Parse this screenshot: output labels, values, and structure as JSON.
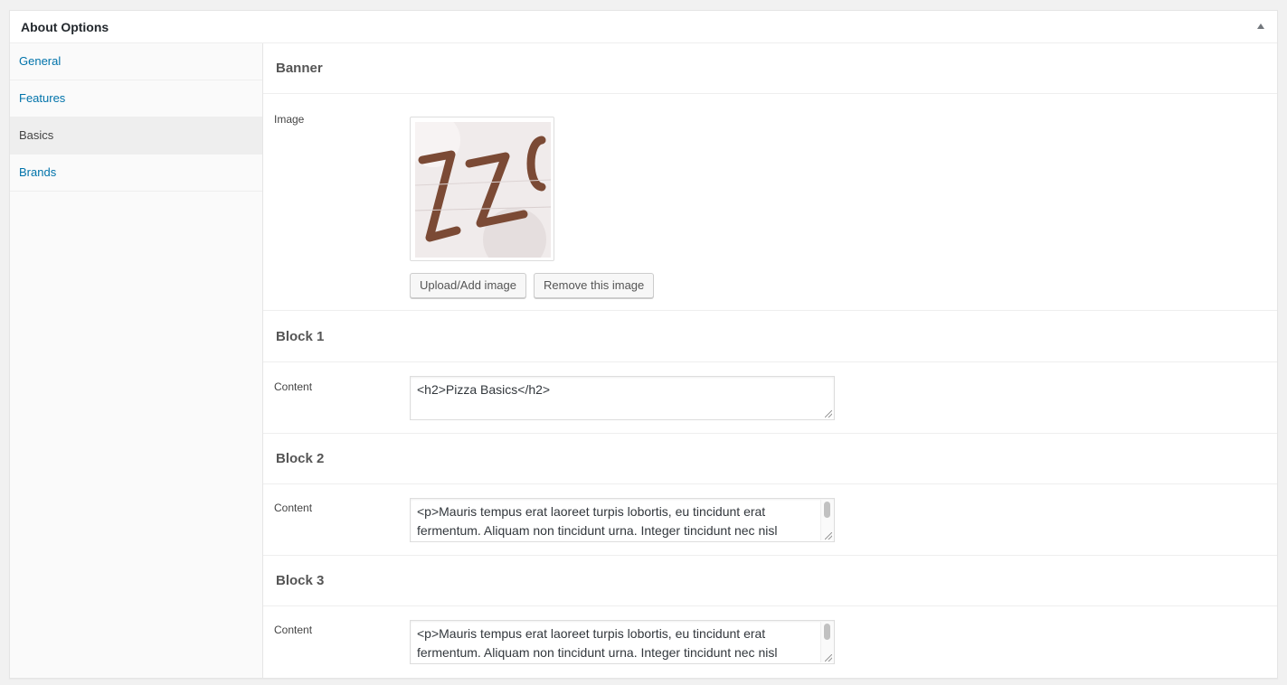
{
  "panel": {
    "title": "About Options"
  },
  "sidebar": {
    "items": [
      {
        "label": "General"
      },
      {
        "label": "Features"
      },
      {
        "label": "Basics"
      },
      {
        "label": "Brands"
      }
    ]
  },
  "banner": {
    "heading": "Banner",
    "image_label": "Image",
    "upload_label": "Upload/Add image",
    "remove_label": "Remove this image"
  },
  "block1": {
    "heading": "Block 1",
    "content_label": "Content",
    "content": "<h2>Pizza Basics</h2>"
  },
  "block2": {
    "heading": "Block 2",
    "content_label": "Content",
    "line1": "<p>Mauris tempus erat laoreet turpis lobortis, eu tincidunt erat",
    "line2": "fermentum.  Aliquam non tincidunt urna. Integer tincidunt nec nisl"
  },
  "block3": {
    "heading": "Block 3",
    "content_label": "Content",
    "line1": "<p>Mauris tempus erat laoreet turpis lobortis, eu tincidunt erat",
    "line2": "fermentum.  Aliquam non tincidunt urna. Integer tincidunt nec nisl"
  },
  "colors": {
    "link": "#0073aa",
    "active_bg": "#eeeeee"
  }
}
